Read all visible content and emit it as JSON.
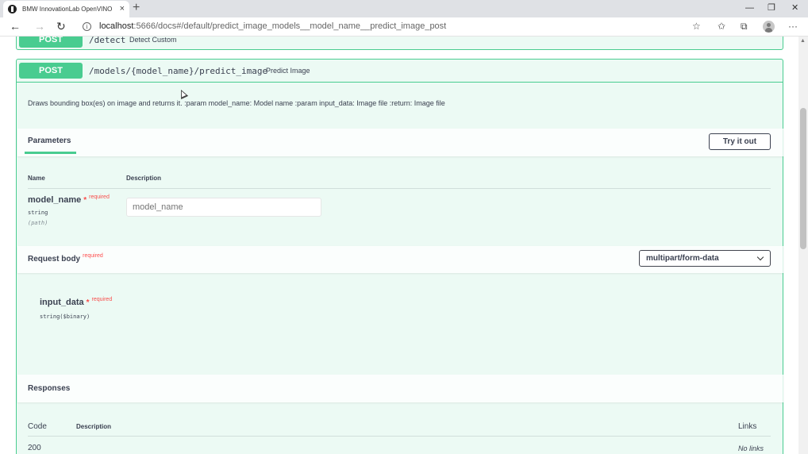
{
  "browser": {
    "tab_title": "BMW InnovationLab OpenVINO",
    "tab_close": "×",
    "new_tab": "+",
    "minimize": "—",
    "restore": "❐",
    "close": "✕",
    "back": "←",
    "forward": "→",
    "reload": "↻",
    "url_host": "localhost",
    "url_path": ":5666/docs#/default/predict_image_models__model_name__predict_image_post",
    "favorite_icon": "☆",
    "favorites_icon": "✩",
    "collections_icon": "⧉",
    "menu_icon": "···"
  },
  "prev_endpoint": {
    "method": "POST",
    "path": "/detect",
    "summary": "Detect Custom"
  },
  "endpoint": {
    "method": "POST",
    "path": "/models/{model_name}/predict_image",
    "summary": "Predict Image",
    "description": "Draws bounding box(es) on image and returns it. :param model_name: Model name :param input_data: Image file :return: Image file"
  },
  "parameters": {
    "title": "Parameters",
    "try_button": "Try it out",
    "col_name": "Name",
    "col_description": "Description",
    "items": [
      {
        "name": "model_name",
        "star": "*",
        "required": "required",
        "type": "string",
        "in": "(path)",
        "placeholder": "model_name"
      }
    ]
  },
  "request_body": {
    "title": "Request body",
    "required": "required",
    "content_type": "multipart/form-data",
    "field_name": "input_data",
    "star": "*",
    "field_required": "required",
    "field_type": "string($binary)"
  },
  "responses": {
    "title": "Responses",
    "col_code": "Code",
    "col_description": "Description",
    "col_links": "Links",
    "rows": [
      {
        "code": "200",
        "links": "No links"
      }
    ]
  }
}
